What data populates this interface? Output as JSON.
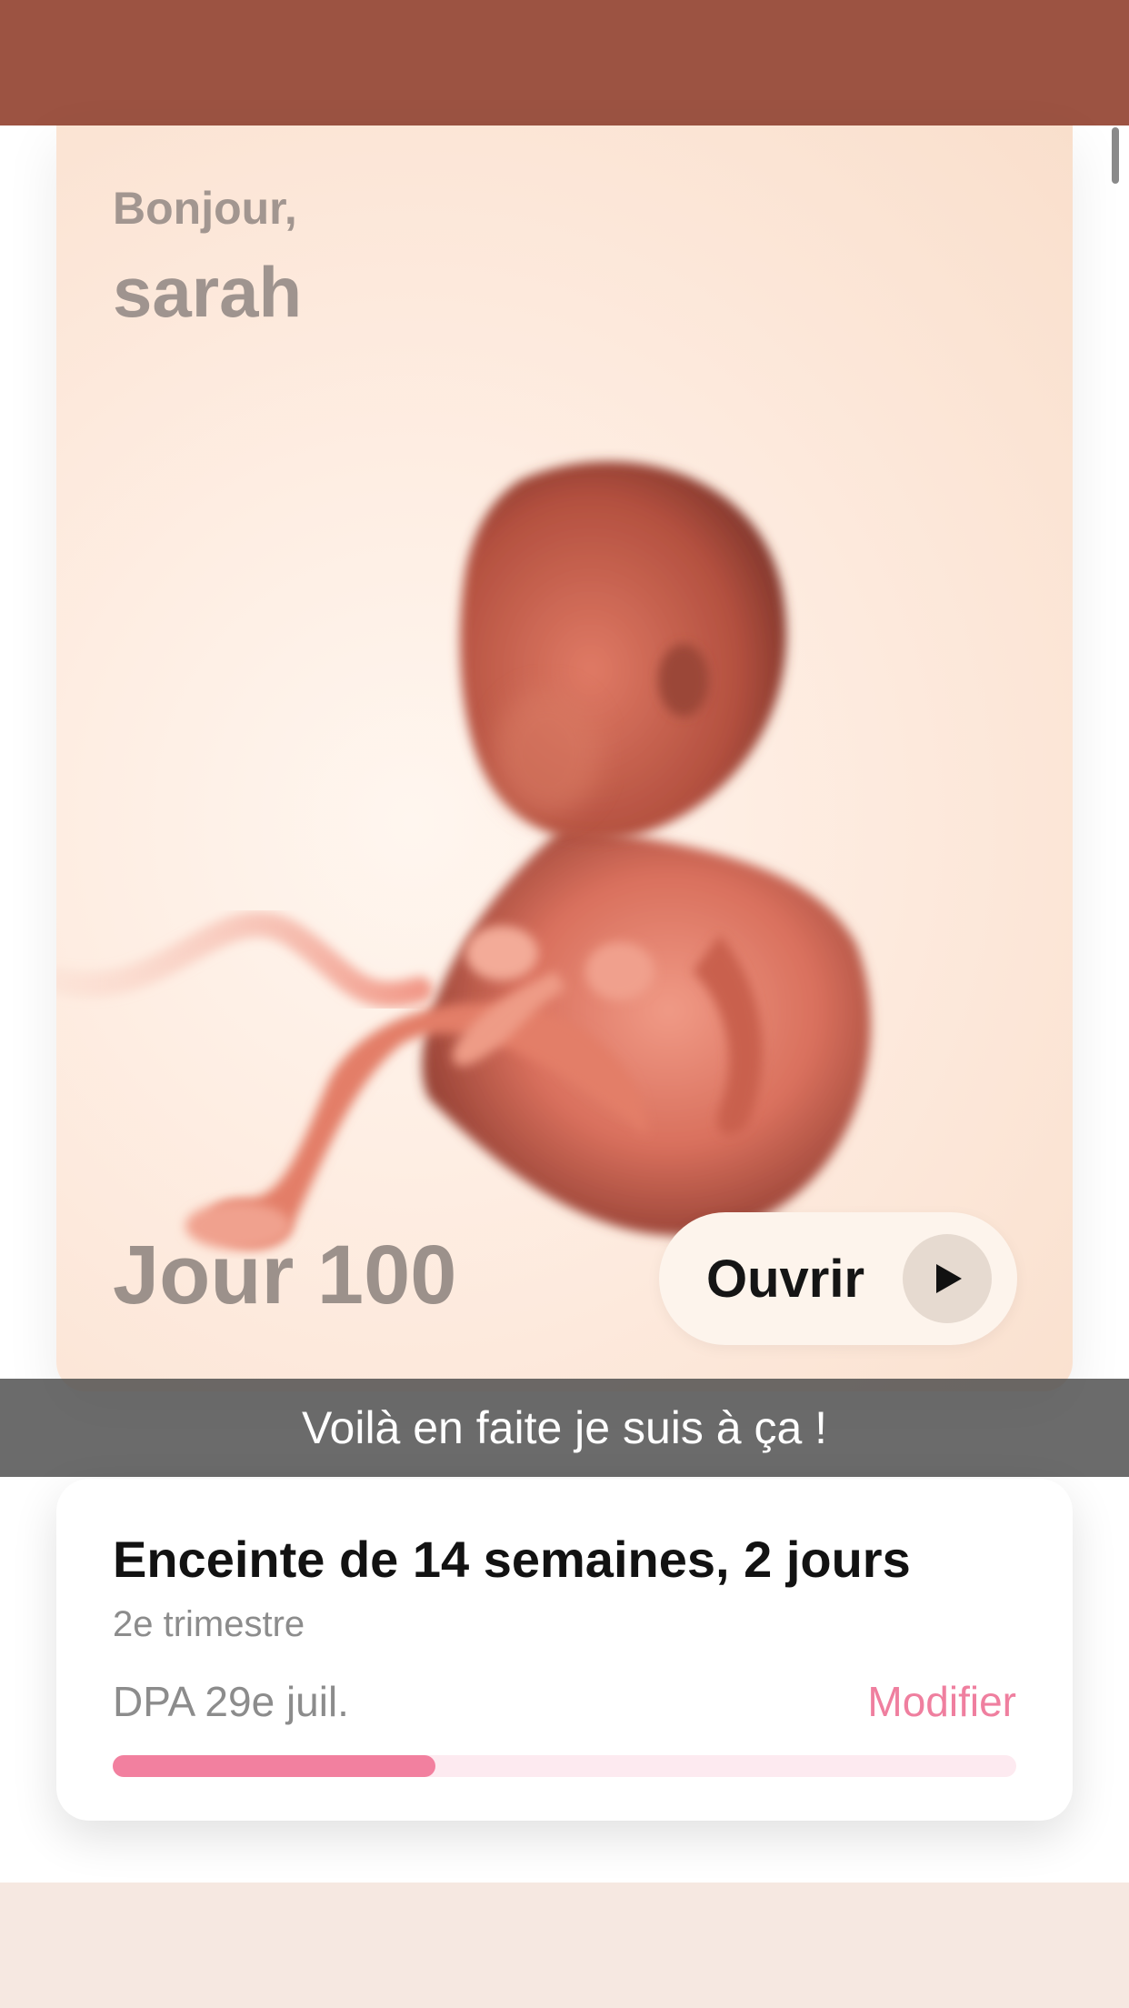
{
  "colors": {
    "status_bar": "#9c5342",
    "accent_pink": "#ef7f9f",
    "progress_fill": "#f2809f",
    "progress_track": "#fdeaf0",
    "bottom_band": "#f6e8e1"
  },
  "hero": {
    "greeting": "Bonjour,",
    "username": "sarah",
    "day_label": "Jour 100",
    "open_button_label": "Ouvrir",
    "play_icon": "play-icon"
  },
  "caption": {
    "text": "Voilà en faite je suis à ça !"
  },
  "pregnancy": {
    "title": "Enceinte de 14 semaines, 2 jours",
    "trimester": "2e trimestre",
    "due_date": "DPA 29e juil.",
    "modify_label": "Modifier",
    "progress_fraction": 0.357
  }
}
